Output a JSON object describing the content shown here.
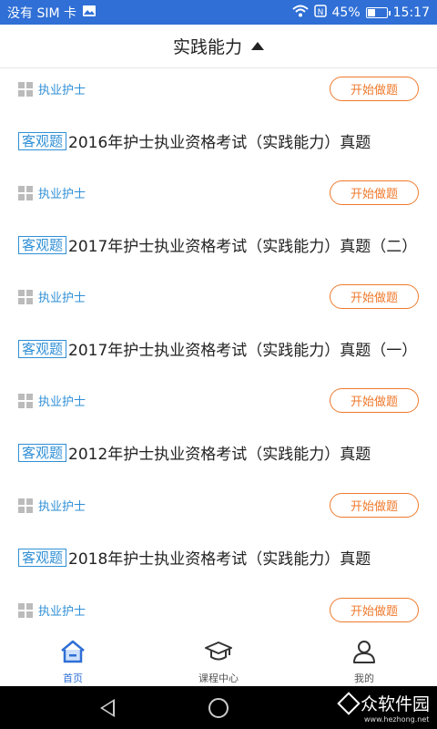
{
  "status_bar": {
    "carrier": "没有 SIM 卡",
    "battery_percent": "45%",
    "battery_level": 0.45,
    "time": "15:17",
    "icons": [
      "image-icon",
      "wifi-icon",
      "nfc-icon",
      "battery-icon"
    ]
  },
  "header": {
    "title": "实践能力",
    "caret_icon": "triangle-up-icon"
  },
  "exam_list": [
    {
      "tag": "",
      "title": "",
      "category": "执业护士",
      "button": "开始做题"
    },
    {
      "tag": "客观题",
      "title": "2016年护士执业资格考试（实践能力）真题",
      "category": "执业护士",
      "button": "开始做题"
    },
    {
      "tag": "客观题",
      "title": "2017年护士执业资格考试（实践能力）真题（二）",
      "category": "执业护士",
      "button": "开始做题"
    },
    {
      "tag": "客观题",
      "title": "2017年护士执业资格考试（实践能力）真题（一）",
      "category": "执业护士",
      "button": "开始做题"
    },
    {
      "tag": "客观题",
      "title": "2012年护士执业资格考试（实践能力）真题",
      "category": "执业护士",
      "button": "开始做题"
    },
    {
      "tag": "客观题",
      "title": "2018年护士执业资格考试（实践能力）真题",
      "category": "执业护士",
      "button": "开始做题"
    }
  ],
  "tab_bar": {
    "tabs": [
      {
        "label": "首页",
        "icon": "home-icon",
        "active": true
      },
      {
        "label": "课程中心",
        "icon": "graduation-cap-icon",
        "active": false
      },
      {
        "label": "我的",
        "icon": "user-icon",
        "active": false
      }
    ]
  },
  "watermark": {
    "name": "众软件园",
    "url": "www.hezhong.net"
  },
  "colors": {
    "status_bar": "#2f6fd6",
    "accent_blue": "#2f8fd6",
    "button_orange": "#ef7a2d"
  }
}
